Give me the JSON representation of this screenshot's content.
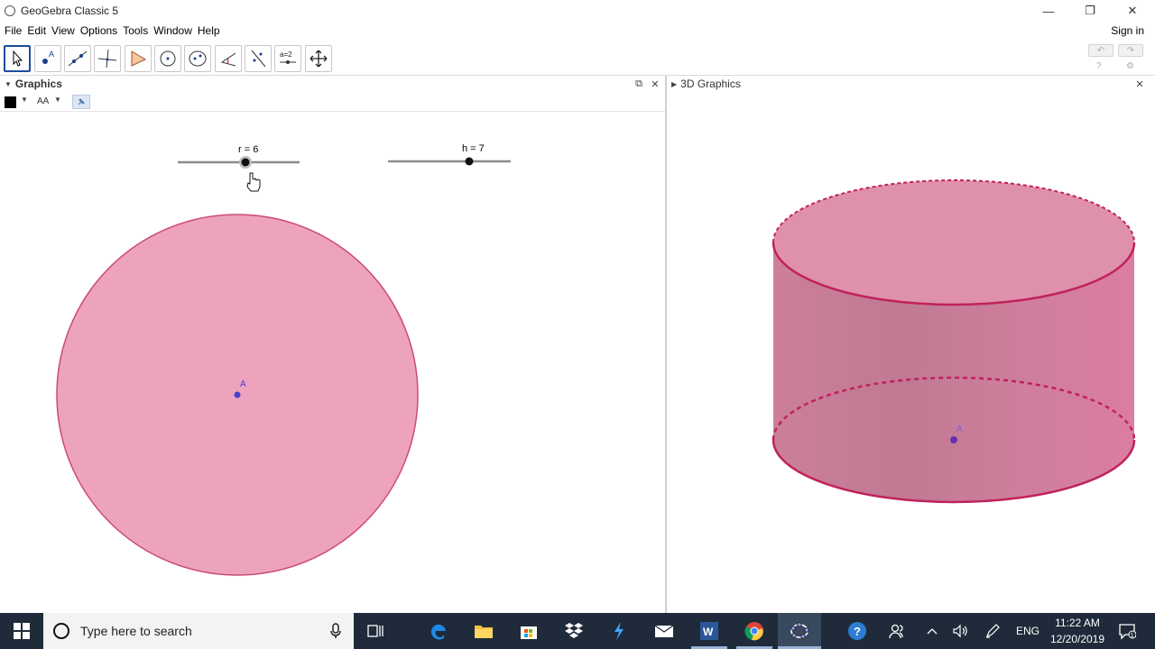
{
  "window": {
    "title": "GeoGebra Classic 5"
  },
  "window_controls": {
    "minimize": "—",
    "restore": "❐",
    "close": "✕"
  },
  "menu": [
    "File",
    "Edit",
    "View",
    "Options",
    "Tools",
    "Window",
    "Help"
  ],
  "sign_in": "Sign in",
  "toolbar": {
    "tools": [
      "move-tool",
      "point-tool",
      "line-tool",
      "perpendicular-line-tool",
      "polygon-tool",
      "circle-with-center-tool",
      "ellipse-tool",
      "angle-tool",
      "reflect-tool",
      "slider-tool",
      "move-graphics-view-tool"
    ],
    "slider_tool_text": "a=2",
    "undo": "↶",
    "redo": "↷"
  },
  "graphics_panel": {
    "title": "Graphics",
    "font_size_label": "AA"
  },
  "view3d_panel": {
    "title": "3D Graphics"
  },
  "sliders": [
    {
      "label": "r = 6",
      "value": 6
    },
    {
      "label": "h = 7",
      "value": 7
    }
  ],
  "point_label": "A",
  "colors": {
    "fill_2d": "#eea3bd",
    "stroke_2d": "#cd4a78",
    "fill_3d": "#de8aa7",
    "stroke_3d": "#c0225c",
    "point": "#4c3fcf",
    "taskbar": "#1f2b3a"
  },
  "taskbar": {
    "search_placeholder": "Type here to search",
    "language": "ENG",
    "time": "11:22 AM",
    "date": "12/20/2019"
  }
}
